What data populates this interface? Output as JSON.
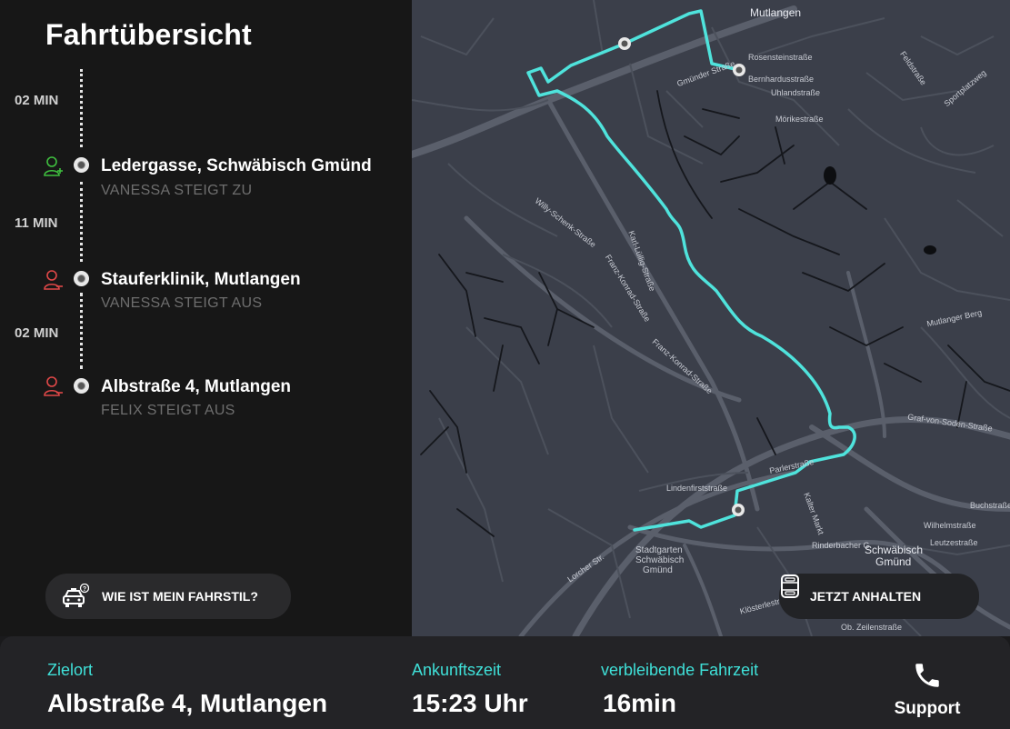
{
  "header": {
    "title": "Fahrtübersicht"
  },
  "timeline": {
    "segments": [
      {
        "duration": "02 MIN"
      },
      {
        "duration": "11 MIN"
      },
      {
        "duration": "02 MIN"
      }
    ],
    "stops": [
      {
        "name": "Ledergasse, Schwäbisch Gmünd",
        "action": "VANESSA STEIGT ZU",
        "type": "pickup",
        "icon": "person-add-icon",
        "color": "#3fbf3f"
      },
      {
        "name": "Stauferklinik, Mutlangen",
        "action": "VANESSA STEIGT AUS",
        "type": "dropoff",
        "icon": "person-remove-icon",
        "color": "#e04848"
      },
      {
        "name": "Albstraße 4, Mutlangen",
        "action": "FELIX STEIGT AUS",
        "type": "dropoff",
        "icon": "person-remove-icon",
        "color": "#e04848"
      }
    ]
  },
  "buttons": {
    "fahrstil_label": "WIE IST MEIN FAHRSTIL?",
    "anhalten_label": "JETZT ANHALTEN",
    "support_label": "Support"
  },
  "map": {
    "route_color": "#4fe3dc",
    "labels": {
      "mutlangen": "Mutlangen",
      "gmuender": "Gmünder Straße",
      "willy": "Willy-Schenk-Straße",
      "franz": "Franz-Konrad-Straße",
      "franz2": "Franz-Konrad-Straße",
      "karl": "Karl-Lüllig-Straße",
      "buchstrasse": "Buchstraße",
      "schwaebisch": "Schwäbisch",
      "gmuend": "Gmünd",
      "stadtgarten": "Stadtgarten",
      "stadtgarten2": "Schwäbisch",
      "stadtgarten3": "Gmünd",
      "lorcher": "Lorcher Str.",
      "graf": "Graf-von-Soden-Straße",
      "mutlanger_berg": "Mutlanger Berg",
      "parler": "Parlerstraße",
      "lindenfirst": "Lindenfirststraße",
      "wilhelm": "Wilhelmstraße",
      "leutze": "Leutzestraße",
      "rinder": "Rinderbacher G.",
      "kloster": "Klösterlestraße",
      "kalter": "Kalter Markt",
      "oberbettringer": "Ob. Zeilenstraße",
      "bernhard": "Bernhardusstraße",
      "rosenstein": "Rosensteinstraße",
      "uhland": "Uhlandstraße",
      "moerike": "Mörikestraße",
      "feld": "Feldstraße",
      "sport": "Sportplatzweg"
    }
  },
  "footer": {
    "destination_label": "Zielort",
    "destination_value": "Albstraße 4, Mutlangen",
    "arrival_label": "Ankunftszeit",
    "arrival_value": "15:23 Uhr",
    "remaining_label": "verbleibende Fahrzeit",
    "remaining_value": "16min"
  },
  "colors": {
    "accent": "#3fe0d8",
    "pickup": "#3fbf3f",
    "dropoff": "#e04848"
  }
}
